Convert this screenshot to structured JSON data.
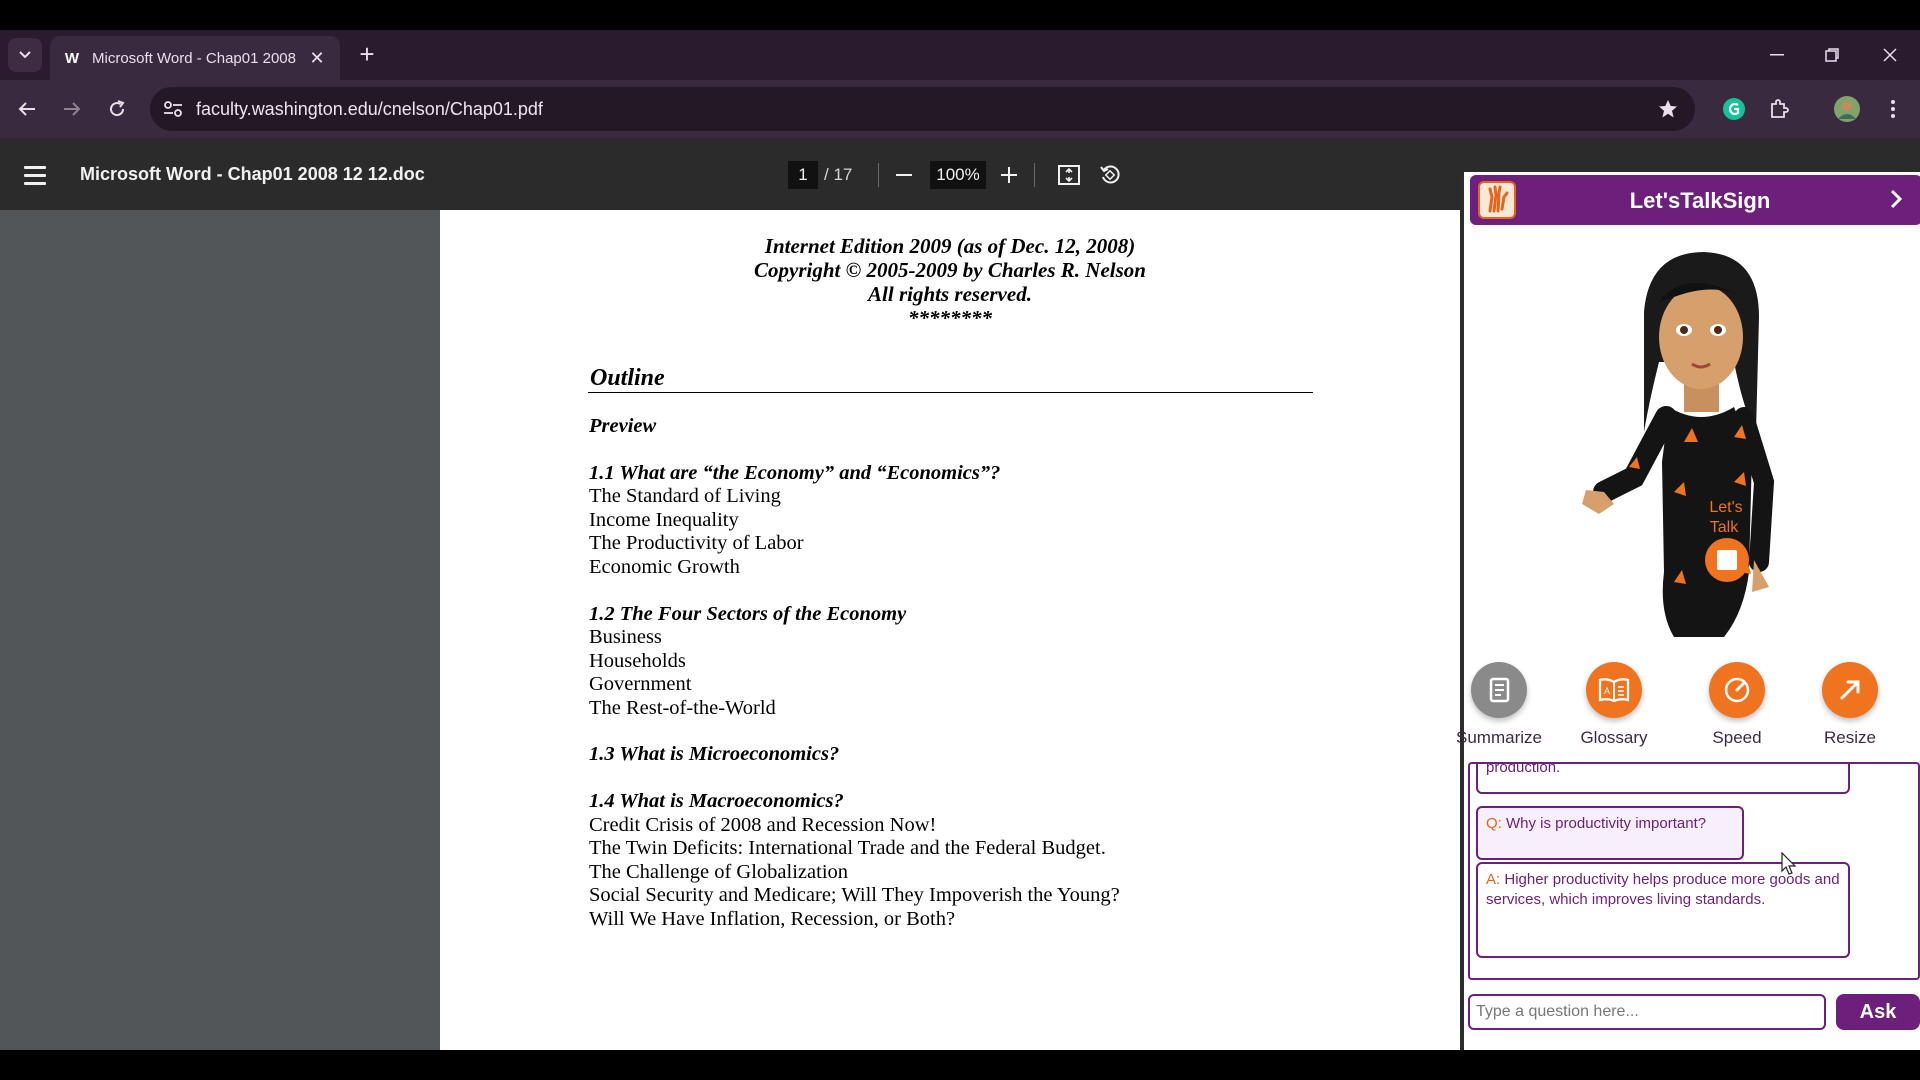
{
  "browser": {
    "tab": {
      "favicon": "W",
      "title": "Microsoft Word - Chap01 2008 12 12.doc"
    },
    "url": "faculty.washington.edu/cnelson/Chap01.pdf",
    "icons": [
      "tab-search-icon",
      "back-icon",
      "forward-icon",
      "reload-icon",
      "site-info-icon",
      "bookmark-star-icon",
      "grammarly-icon",
      "extensions-icon",
      "profile-avatar",
      "menu-dots-icon",
      "minimize-icon",
      "restore-icon",
      "close-icon"
    ]
  },
  "pdf": {
    "title": "Microsoft Word - Chap01 2008 12 12.doc",
    "page_current": "1",
    "page_total": "/ 17",
    "zoom": "100%",
    "header": [
      "Internet Edition 2009 (as of Dec. 12, 2008)",
      "Copyright © 2005-2009 by Charles R. Nelson",
      "All rights reserved.",
      "********"
    ],
    "outline_title": "Outline",
    "lines": [
      {
        "text": "Preview",
        "bold": true
      },
      {
        "text": "1.1 What are “the Economy” and “Economics”?",
        "bold": true
      },
      {
        "text": "The Standard of Living",
        "bold": false
      },
      {
        "text": "Income Inequality",
        "bold": false
      },
      {
        "text": "The Productivity of Labor",
        "bold": false
      },
      {
        "text": "Economic Growth",
        "bold": false
      },
      {
        "text": "1.2 The Four Sectors of the Economy",
        "bold": true
      },
      {
        "text": "Business",
        "bold": false
      },
      {
        "text": "Households",
        "bold": false
      },
      {
        "text": "Government",
        "bold": false
      },
      {
        "text": "The Rest-of-the-World",
        "bold": false
      },
      {
        "text": "1.3 What is Microeconomics?",
        "bold": true
      },
      {
        "text": "1.4 What is Macroeconomics?",
        "bold": true
      },
      {
        "text": "Credit Crisis of 2008 and Recession Now!",
        "bold": false
      },
      {
        "text": "The Twin Deficits: International Trade and the Federal Budget.",
        "bold": false
      },
      {
        "text": "The Challenge of Globalization",
        "bold": false
      },
      {
        "text": "Social Security and Medicare; Will They Impoverish the Young?",
        "bold": false
      },
      {
        "text": "Will We Have Inflation, Recession, or Both?",
        "bold": false
      }
    ]
  },
  "lts": {
    "title": "Let'sTalkSign",
    "dress_text": [
      "Let's",
      "Talk"
    ],
    "tools": [
      {
        "label": "Summarize",
        "icon": "summarize-icon",
        "color": "#8a8a8a"
      },
      {
        "label": "Glossary",
        "icon": "glossary-book-icon",
        "color": "#f0731f"
      },
      {
        "label": "Speed",
        "icon": "speed-gauge-icon",
        "color": "#f0731f"
      },
      {
        "label": "Resize",
        "icon": "resize-arrow-icon",
        "color": "#f0731f"
      }
    ],
    "chat": {
      "prev_fragment": "production.",
      "q_prefix": "Q:",
      "question": "Why is productivity important?",
      "a_prefix": "A:",
      "answer": "Higher productivity helps produce more goods and services, which improves living standards."
    },
    "input_placeholder": "Type a question here...",
    "ask_label": "Ask"
  },
  "colors": {
    "brand_purple": "#6d1f7c",
    "brand_orange": "#e7651b",
    "chrome_dark": "#2a1b2e",
    "viewer_bg": "#525659"
  }
}
